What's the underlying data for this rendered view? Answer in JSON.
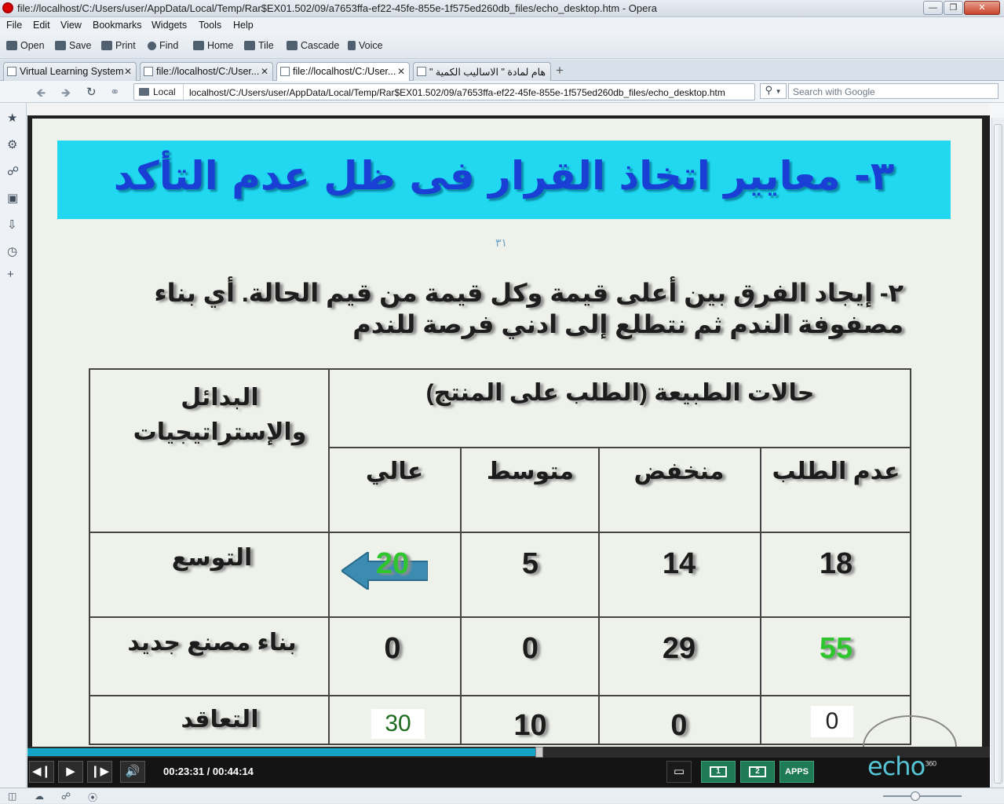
{
  "window": {
    "title": "file://localhost/C:/Users/user/AppData/Local/Temp/Rar$EX01.502/09/a7653ffa-ef22-45fe-855e-1f575ed260db_files/echo_desktop.htm - Opera"
  },
  "menu": [
    "File",
    "Edit",
    "View",
    "Bookmarks",
    "Widgets",
    "Tools",
    "Help"
  ],
  "toolbar": {
    "open": "Open",
    "save": "Save",
    "print": "Print",
    "find": "Find",
    "home": "Home",
    "tile": "Tile",
    "cascade": "Cascade",
    "voice": "Voice"
  },
  "tabs": [
    {
      "label": "Virtual Learning System"
    },
    {
      "label": "file://localhost/C:/User..."
    },
    {
      "label": "file://localhost/C:/User..."
    },
    {
      "label": "\" هام لمادة \" الاساليب الكمية"
    }
  ],
  "address": {
    "location_label": "Local",
    "url": "localhost/C:/Users/user/AppData/Local/Temp/Rar$EX01.502/09/a7653ffa-ef22-45fe-855e-1f575ed260db_files/echo_desktop.htm",
    "search_placeholder": "Search with Google"
  },
  "slide": {
    "title": "٣- معايير اتخاذ القرار فى ظل عدم التأكد",
    "page_number": "٣١",
    "paragraph": "٢- إيجاد الفرق بين أعلى قيمة وكل قيمة من قيم الحالة. أي بناء مصفوفة الندم ثم نتطلع إلى ادني فرصة للندم",
    "table": {
      "alternatives_header": "البدائل والإستراتيجيات",
      "states_header": "حالات الطبيعة (الطلب على المنتج)",
      "columns": [
        "عدم الطلب",
        "منخفض",
        "متوسط",
        "عالي"
      ],
      "rows": [
        {
          "label": "التوسع",
          "values": [
            "18",
            "14",
            "5",
            "20"
          ]
        },
        {
          "label": "بناء مصنع جديد",
          "values": [
            "55",
            "29",
            "0",
            "0"
          ]
        },
        {
          "label": "التعاقد",
          "values": [
            "0",
            "0",
            "10",
            "30"
          ]
        }
      ],
      "highlight_color": "#2fc52f"
    }
  },
  "player": {
    "time": "00:23:31 / 00:44:14",
    "progress_fraction": 0.532,
    "view1": "1",
    "view2": "2",
    "apps": "APPS",
    "brand": "echo",
    "brand_sup": "360"
  },
  "colors": {
    "title_band": "#21d8f0",
    "title_text": "#1a3fd4",
    "progress": "#14a3c4",
    "view_buttons": "#1e7b56"
  }
}
